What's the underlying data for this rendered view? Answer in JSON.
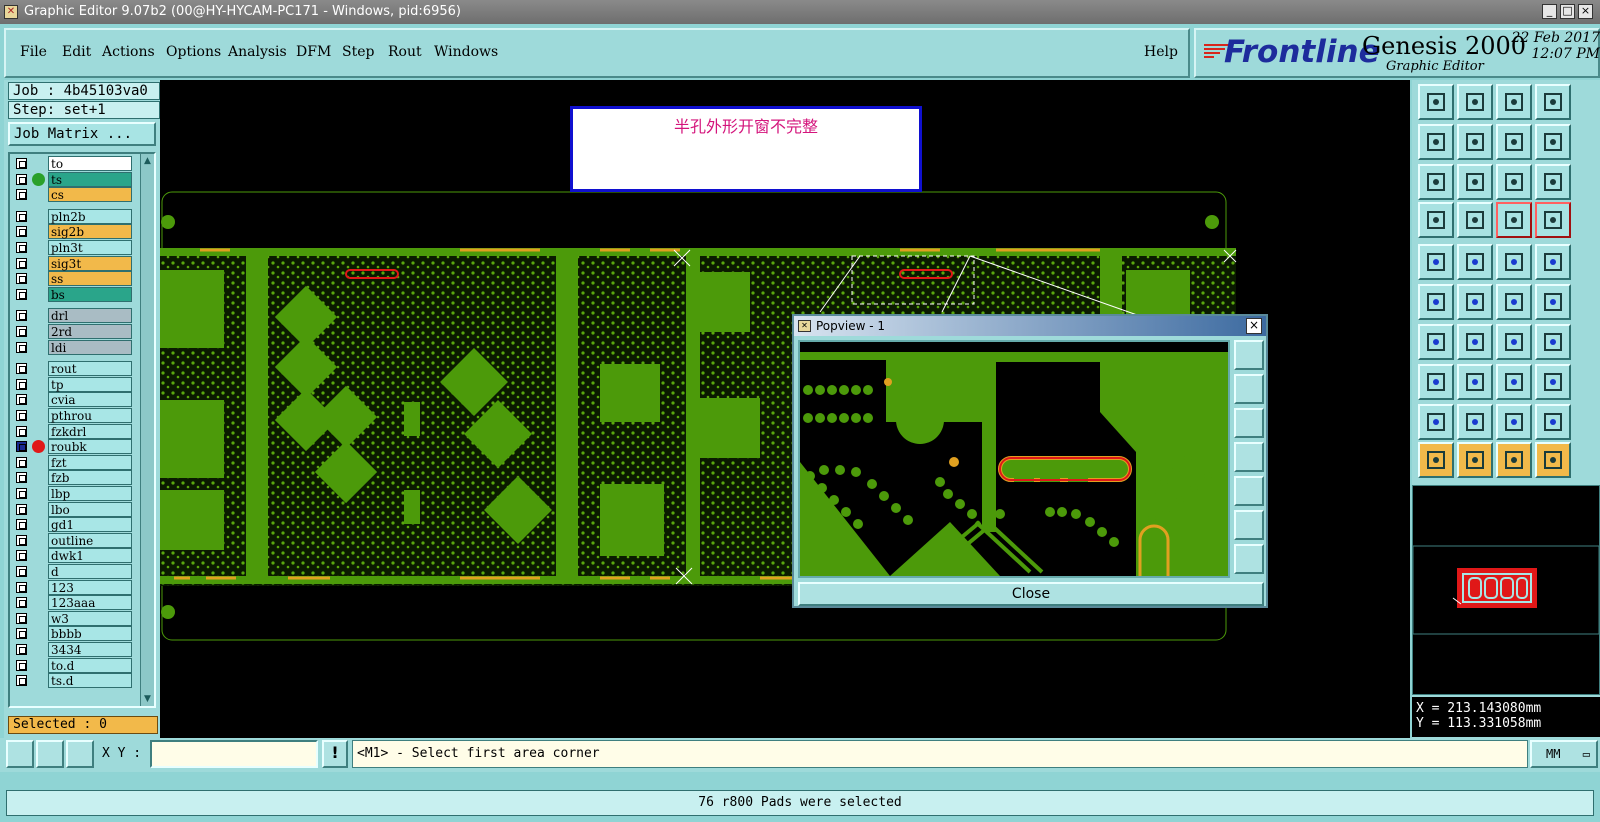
{
  "window": {
    "title": "Graphic Editor 9.07b2 (00@HY-HYCAM-PC171 - Windows, pid:6956)"
  },
  "menu": {
    "file": "File",
    "edit": "Edit",
    "actions": "Actions",
    "options": "Options",
    "analysis": "Analysis",
    "dfm": "DFM",
    "step": "Step",
    "rout": "Rout",
    "windows": "Windows",
    "help": "Help"
  },
  "brand": {
    "logo": "Frontline",
    "product": "Genesis 2000",
    "subtitle": "Graphic Editor",
    "date": "22 Feb 2017",
    "time": "12:07 PM"
  },
  "job": {
    "job_label": "Job : 4b45103va0",
    "step_label": "Step: set+1",
    "matrix_button": "Job Matrix ..."
  },
  "layers": [
    {
      "name": "to",
      "color": "#ffffff"
    },
    {
      "name": "ts",
      "color": "#2aa58a",
      "dot": "#2aa02a"
    },
    {
      "name": "cs",
      "color": "#f2b94a"
    },
    {
      "name": "pln2b",
      "color": "#a8e6e6"
    },
    {
      "name": "sig2b",
      "color": "#f2b94a"
    },
    {
      "name": "pln3t",
      "color": "#a8e6e6"
    },
    {
      "name": "sig3t",
      "color": "#f2b94a"
    },
    {
      "name": "ss",
      "color": "#f2b94a"
    },
    {
      "name": "bs",
      "color": "#2aa58a"
    },
    {
      "name": "drl",
      "color": "#a9bcc4"
    },
    {
      "name": "2rd",
      "color": "#a9bcc4"
    },
    {
      "name": "ldi",
      "color": "#a9bcc4"
    },
    {
      "name": "rout",
      "color": "#a8e6e6"
    },
    {
      "name": "tp",
      "color": "#a8e6e6"
    },
    {
      "name": "cvia",
      "color": "#a8e6e6"
    },
    {
      "name": "pthrou",
      "color": "#a8e6e6"
    },
    {
      "name": "fzkdrl",
      "color": "#a8e6e6"
    },
    {
      "name": "roubk",
      "color": "#a8e6e6",
      "dot": "#e01818",
      "checked": true
    },
    {
      "name": "fzt",
      "color": "#a8e6e6"
    },
    {
      "name": "fzb",
      "color": "#a8e6e6"
    },
    {
      "name": "lbp",
      "color": "#a8e6e6"
    },
    {
      "name": "lbo",
      "color": "#a8e6e6"
    },
    {
      "name": "gd1",
      "color": "#a8e6e6"
    },
    {
      "name": "outline",
      "color": "#a8e6e6"
    },
    {
      "name": "dwk1",
      "color": "#a8e6e6"
    },
    {
      "name": "d",
      "color": "#a8e6e6"
    },
    {
      "name": "123",
      "color": "#a8e6e6"
    },
    {
      "name": "123aaa",
      "color": "#a8e6e6"
    },
    {
      "name": "w3",
      "color": "#a8e6e6"
    },
    {
      "name": "bbbb",
      "color": "#a8e6e6"
    },
    {
      "name": "3434",
      "color": "#a8e6e6"
    },
    {
      "name": "to.d",
      "color": "#a8e6e6"
    },
    {
      "name": "ts.d",
      "color": "#a8e6e6"
    }
  ],
  "selected_label": "Selected : 0",
  "annotation_note": "半孔外形开窗不完整",
  "popview": {
    "title": "Popview - 1",
    "close_label": "Close"
  },
  "coords": {
    "x": "X = 213.143080mm",
    "y": "Y = 113.331058mm"
  },
  "bottom": {
    "xy_label": "X Y :",
    "xy_value": "",
    "prompt": "<M1> - Select first area corner",
    "units": "MM"
  },
  "status": "76 r800 Pads were selected",
  "colors": {
    "panel": "#9edada",
    "copper": "#4c9a0a",
    "pad_orange": "#e0a020",
    "selection_red": "#e01818"
  }
}
